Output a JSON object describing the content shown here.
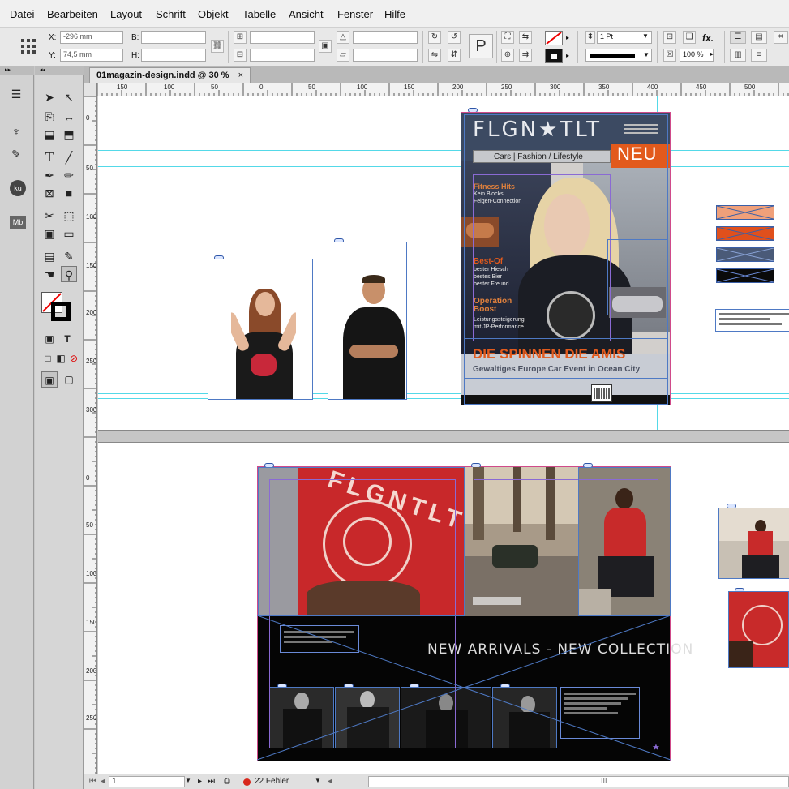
{
  "menu": [
    "Datei",
    "Bearbeiten",
    "Layout",
    "Schrift",
    "Objekt",
    "Tabelle",
    "Ansicht",
    "Fenster",
    "Hilfe"
  ],
  "control": {
    "x_label": "X:",
    "x_value": "-296 mm",
    "y_label": "Y:",
    "y_value": "74,5 mm",
    "b_label": "B:",
    "h_label": "H:",
    "stroke_weight": "1 Pt",
    "zoom_pct": "100 %",
    "fx": "fx.",
    "p_glyph": "P"
  },
  "document_tab": {
    "title": "01magazin-design.indd @ 30 %",
    "close": "×"
  },
  "hruler_ticks": [
    "150",
    "100",
    "50",
    "0",
    "50",
    "100",
    "150",
    "200",
    "250",
    "300",
    "350",
    "400",
    "450",
    "500"
  ],
  "vruler_ticks": [
    "0",
    "50",
    "100",
    "150",
    "200",
    "250",
    "300",
    "0",
    "50",
    "100",
    "150",
    "200",
    "250"
  ],
  "panel_badges": {
    "ku": "ku",
    "mb": "Mb"
  },
  "magazine": {
    "logo": "FLGN★TLT",
    "tagline": "Cars | Fashion / Lifestyle",
    "badge": "NEU",
    "topic1_title": "Fitness Hits",
    "topic1_lines": [
      "Kein Blocks",
      "Felgen-Connection"
    ],
    "topic2_title": "Best-Of",
    "topic2_lines": [
      "bester Hiesch",
      "bestes Bier",
      "bester Freund"
    ],
    "topic3_title": "Operation Boost",
    "topic3_lines": [
      "Leistungssteigerung",
      "mit JP-Performance"
    ],
    "headline": "DIE SPINNEN DIE AMIS",
    "subheadline": "Gewaltiges Europe Car Event in Ocean City"
  },
  "spread": {
    "banner": "NEW  ARRIVALS - NEW COLLECTION",
    "shirt_text": "FLGNTLT"
  },
  "colors": {
    "accent_orange": "#e25a1c",
    "swatch_peach": "#f0a07a",
    "swatch_orange": "#e0501c",
    "swatch_slate": "#4a5a78",
    "swatch_black": "#0a0a0a",
    "guide": "#53d9e8",
    "frame": "#4e79c4"
  },
  "status": {
    "page": "1",
    "errors": "22 Fehler",
    "scroll_marker": "III"
  }
}
